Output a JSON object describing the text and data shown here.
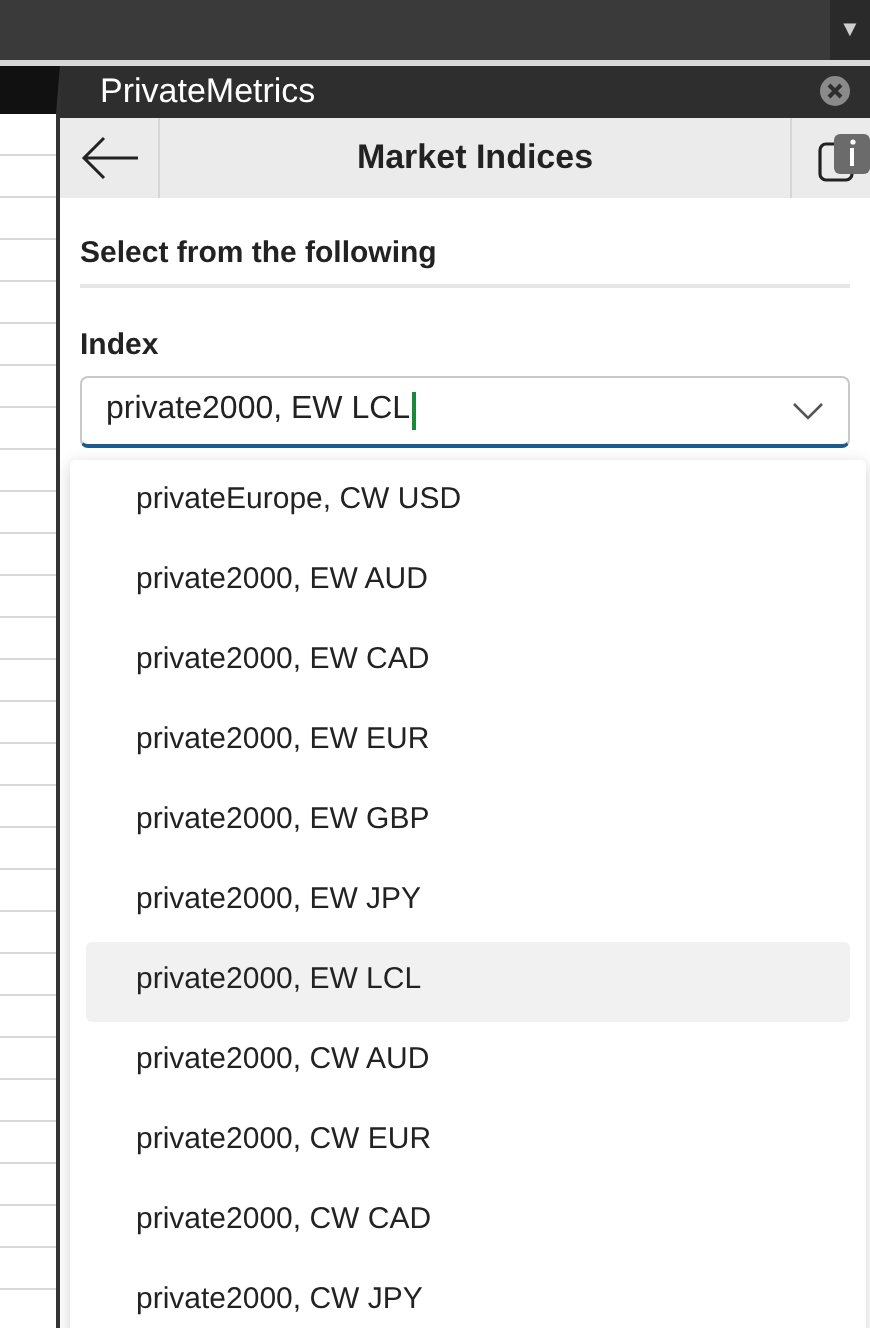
{
  "top_bar": {
    "menu_glyph": "▼"
  },
  "panel": {
    "title": "PrivateMetrics"
  },
  "header": {
    "title": "Market Indices"
  },
  "section": {
    "heading": "Select from the following"
  },
  "index_field": {
    "label": "Index",
    "value": "private2000, EW LCL",
    "expanded": true
  },
  "options": [
    {
      "label": "privateEurope, CW USD",
      "selected": false
    },
    {
      "label": "private2000, EW AUD",
      "selected": false
    },
    {
      "label": "private2000, EW CAD",
      "selected": false
    },
    {
      "label": "private2000, EW EUR",
      "selected": false
    },
    {
      "label": "private2000, EW GBP",
      "selected": false
    },
    {
      "label": "private2000, EW JPY",
      "selected": false
    },
    {
      "label": "private2000, EW LCL",
      "selected": true
    },
    {
      "label": "private2000, CW AUD",
      "selected": false
    },
    {
      "label": "private2000, CW EUR",
      "selected": false
    },
    {
      "label": "private2000, CW CAD",
      "selected": false
    },
    {
      "label": "private2000, CW JPY",
      "selected": false
    }
  ]
}
